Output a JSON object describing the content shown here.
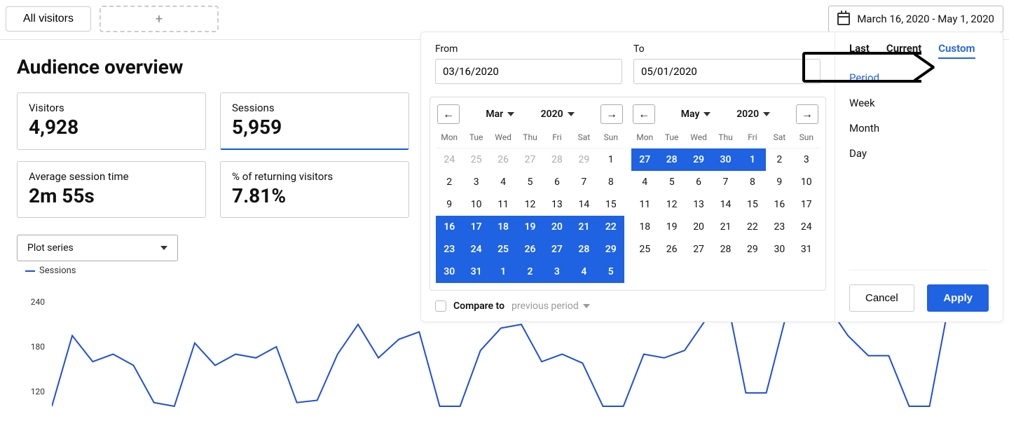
{
  "top": {
    "segment_label": "All visitors",
    "add_segment_glyph": "+",
    "date_range_display": "March 16, 2020 - May 1, 2020"
  },
  "title": "Audience overview",
  "cards": [
    {
      "label": "Visitors",
      "value": "4,928",
      "active": false
    },
    {
      "label": "Sessions",
      "value": "5,959",
      "active": true
    },
    {
      "label": "Average session time",
      "value": "2m 55s",
      "active": false
    },
    {
      "label": "% of returning visitors",
      "value": "7.81%",
      "active": false
    }
  ],
  "plot_select_label": "Plot series",
  "legend_label": "Sessions",
  "chart_data": {
    "type": "line",
    "ylabel": "",
    "title": "",
    "ylim": [
      100,
      260
    ],
    "yticks": [
      240,
      180,
      120
    ],
    "x": [
      0,
      1,
      2,
      3,
      4,
      5,
      6,
      7,
      8,
      9,
      10,
      11,
      12,
      13,
      14,
      15,
      16,
      17,
      18,
      19,
      20,
      21,
      22,
      23,
      24,
      25,
      26,
      27,
      28,
      29,
      30,
      31,
      32,
      33,
      34,
      35,
      36,
      37,
      38,
      39,
      40,
      41,
      42,
      43,
      44,
      45,
      46
    ],
    "series": [
      {
        "name": "Sessions",
        "color": "#1e4fd6",
        "values": [
          100,
          195,
          160,
          170,
          155,
          105,
          100,
          185,
          155,
          170,
          165,
          180,
          105,
          108,
          170,
          210,
          165,
          190,
          200,
          100,
          100,
          175,
          205,
          210,
          160,
          170,
          158,
          100,
          100,
          170,
          165,
          175,
          215,
          255,
          118,
          118,
          225,
          255,
          235,
          195,
          168,
          168,
          100,
          100,
          245,
          230,
          255
        ]
      }
    ]
  },
  "datepicker": {
    "from_label": "From",
    "to_label": "To",
    "from_value": "03/16/2020",
    "to_value": "05/01/2020",
    "weekdays": [
      "Mon",
      "Tue",
      "Wed",
      "Thu",
      "Fri",
      "Sat",
      "Sun"
    ],
    "left_cal": {
      "month": "Mar",
      "year": "2020",
      "days": [
        {
          "n": "24",
          "out": true
        },
        {
          "n": "25",
          "out": true
        },
        {
          "n": "26",
          "out": true
        },
        {
          "n": "27",
          "out": true
        },
        {
          "n": "28",
          "out": true
        },
        {
          "n": "29",
          "out": true
        },
        {
          "n": "1"
        },
        {
          "n": "2"
        },
        {
          "n": "3"
        },
        {
          "n": "4"
        },
        {
          "n": "5"
        },
        {
          "n": "6"
        },
        {
          "n": "7"
        },
        {
          "n": "8"
        },
        {
          "n": "9"
        },
        {
          "n": "10"
        },
        {
          "n": "11"
        },
        {
          "n": "12"
        },
        {
          "n": "13"
        },
        {
          "n": "14"
        },
        {
          "n": "15"
        },
        {
          "n": "16",
          "sel": true
        },
        {
          "n": "17",
          "sel": true
        },
        {
          "n": "18",
          "sel": true
        },
        {
          "n": "19",
          "sel": true
        },
        {
          "n": "20",
          "sel": true
        },
        {
          "n": "21",
          "sel": true
        },
        {
          "n": "22",
          "sel": true
        },
        {
          "n": "23",
          "sel": true
        },
        {
          "n": "24",
          "sel": true
        },
        {
          "n": "25",
          "sel": true
        },
        {
          "n": "26",
          "sel": true
        },
        {
          "n": "27",
          "sel": true
        },
        {
          "n": "28",
          "sel": true
        },
        {
          "n": "29",
          "sel": true
        },
        {
          "n": "30",
          "sel": true
        },
        {
          "n": "31",
          "sel": true
        },
        {
          "n": "1",
          "sel": true,
          "out": true
        },
        {
          "n": "2",
          "sel": true,
          "out": true
        },
        {
          "n": "3",
          "sel": true,
          "out": true
        },
        {
          "n": "4",
          "sel": true,
          "out": true
        },
        {
          "n": "5",
          "sel": true,
          "out": true
        }
      ]
    },
    "right_cal": {
      "month": "May",
      "year": "2020",
      "days": [
        {
          "n": "27",
          "sel": true,
          "out": true
        },
        {
          "n": "28",
          "sel": true,
          "out": true
        },
        {
          "n": "29",
          "sel": true,
          "out": true
        },
        {
          "n": "30",
          "sel": true,
          "out": true
        },
        {
          "n": "1",
          "sel": true
        },
        {
          "n": "2"
        },
        {
          "n": "3"
        },
        {
          "n": "4"
        },
        {
          "n": "5"
        },
        {
          "n": "6"
        },
        {
          "n": "7"
        },
        {
          "n": "8"
        },
        {
          "n": "9"
        },
        {
          "n": "10"
        },
        {
          "n": "11"
        },
        {
          "n": "12"
        },
        {
          "n": "13"
        },
        {
          "n": "14"
        },
        {
          "n": "15"
        },
        {
          "n": "16"
        },
        {
          "n": "17"
        },
        {
          "n": "18"
        },
        {
          "n": "19"
        },
        {
          "n": "20"
        },
        {
          "n": "21"
        },
        {
          "n": "22"
        },
        {
          "n": "23"
        },
        {
          "n": "24"
        },
        {
          "n": "25"
        },
        {
          "n": "26"
        },
        {
          "n": "27"
        },
        {
          "n": "28"
        },
        {
          "n": "29"
        },
        {
          "n": "30"
        },
        {
          "n": "31"
        }
      ]
    },
    "compare_label": "Compare to",
    "compare_option": "previous period",
    "tabs": [
      "Last",
      "Current",
      "Custom"
    ],
    "active_tab": "Custom",
    "options": [
      "Period",
      "Week",
      "Month",
      "Day"
    ],
    "active_option": "Period",
    "cancel_label": "Cancel",
    "apply_label": "Apply"
  }
}
